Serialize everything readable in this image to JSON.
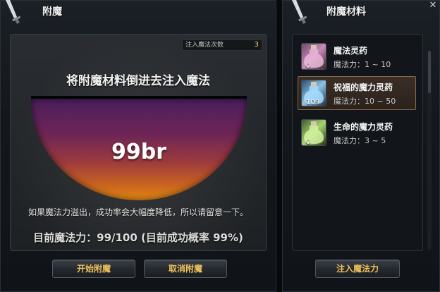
{
  "left_panel": {
    "title": "附魔",
    "count_label": "注入魔法次数",
    "count_value": "3",
    "instruction": "将附魔材料倒进去注入魔法",
    "bowl_value": "99br",
    "warning": "如果魔法力溢出，成功率会大幅度降低，所以请留意一下。",
    "status": "目前魔法力：99/100 (目前成功概率 99%)",
    "buttons": {
      "start": "开始附魔",
      "cancel": "取消附魔"
    }
  },
  "right_panel": {
    "title": "附魔材料",
    "close": "✕",
    "items": [
      {
        "name": "魔法灵药",
        "stat": "魔法力：1 ~ 10",
        "count": "0",
        "selected": false,
        "icon": "pink-potion-icon"
      },
      {
        "name": "祝福的魔力灵药",
        "stat": "魔法力：10 ~ 50",
        "count": "109",
        "selected": true,
        "icon": "blue-potion-icon"
      },
      {
        "name": "生命的魔力灵药",
        "stat": "魔法力：3 ~ 5",
        "count": "0",
        "selected": false,
        "icon": "green-potion-icon"
      }
    ],
    "inject_button": "注入魔法力"
  },
  "colors": {
    "button_text": "#f0c25a",
    "count_value": "#e8c96a",
    "selected_border": "#8a6a4b"
  }
}
